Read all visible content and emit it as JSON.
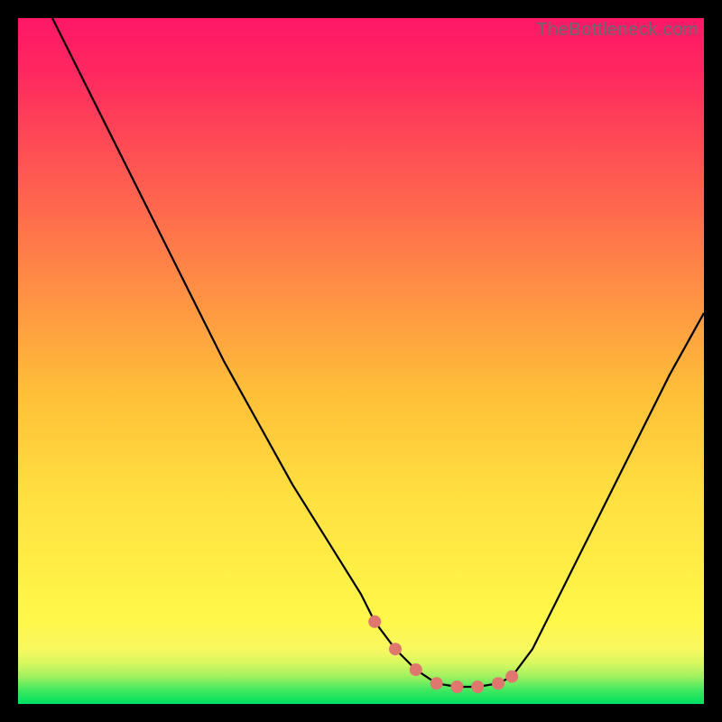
{
  "watermark": "TheBottleneck.com",
  "chart_data": {
    "type": "line",
    "title": "",
    "xlabel": "",
    "ylabel": "",
    "xlim": [
      0,
      100
    ],
    "ylim": [
      0,
      100
    ],
    "series": [
      {
        "name": "curve",
        "x": [
          5,
          10,
          15,
          20,
          25,
          30,
          35,
          40,
          45,
          50,
          52,
          55,
          58,
          61,
          64,
          67,
          70,
          72,
          75,
          80,
          85,
          90,
          95,
          100
        ],
        "values": [
          100,
          90,
          80,
          70,
          60,
          50,
          41,
          32,
          24,
          16,
          12,
          8,
          5,
          3,
          2.5,
          2.5,
          3,
          4,
          8,
          18,
          28,
          38,
          48,
          57
        ]
      },
      {
        "name": "dots",
        "x": [
          52,
          55,
          58,
          61,
          64,
          67,
          70,
          72
        ],
        "values": [
          12,
          8,
          5,
          3,
          2.5,
          2.5,
          3,
          4
        ]
      }
    ],
    "colors": {
      "curve": "#000000",
      "dots": "#e0776f"
    }
  }
}
